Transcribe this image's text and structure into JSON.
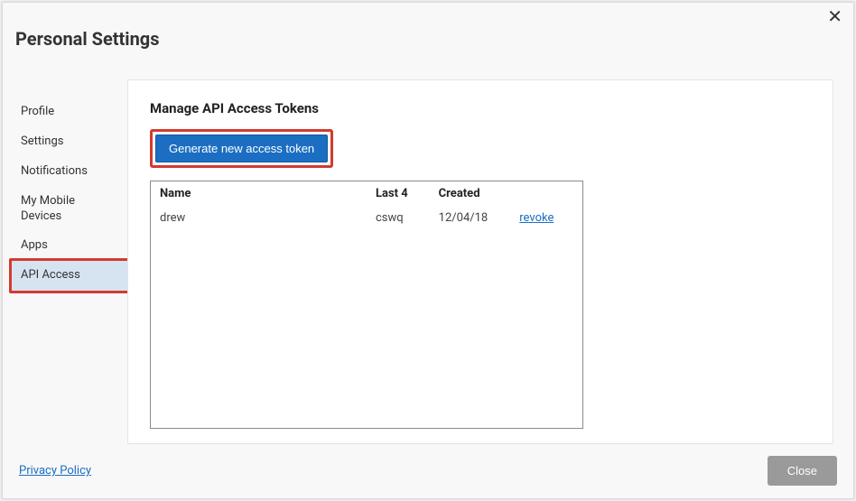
{
  "dialog": {
    "title": "Personal Settings",
    "close_glyph": "✕"
  },
  "sidebar": {
    "items": [
      {
        "label": "Profile",
        "active": false
      },
      {
        "label": "Settings",
        "active": false
      },
      {
        "label": "Notifications",
        "active": false
      },
      {
        "label": "My Mobile Devices",
        "active": false
      },
      {
        "label": "Apps",
        "active": false
      },
      {
        "label": "API Access",
        "active": true,
        "highlighted": true
      }
    ]
  },
  "main": {
    "heading": "Manage API Access Tokens",
    "generate_button": "Generate new access token",
    "table": {
      "headers": {
        "name": "Name",
        "last4": "Last 4",
        "created": "Created"
      },
      "rows": [
        {
          "name": "drew",
          "last4": "cswq",
          "created": "12/04/18",
          "action": "revoke"
        }
      ]
    }
  },
  "footer": {
    "privacy": "Privacy Policy",
    "close": "Close"
  }
}
